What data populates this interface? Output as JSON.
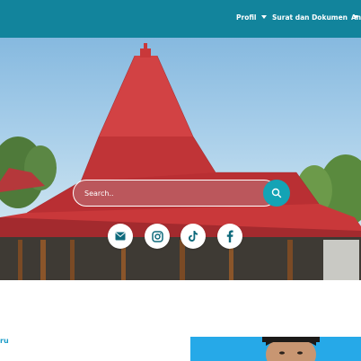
{
  "navbar": {
    "background": "#12849c",
    "items": [
      {
        "label": "Profil",
        "has_dropdown": true
      },
      {
        "label": "Surat dan Dokumen",
        "has_dropdown": true
      },
      {
        "label": "An",
        "has_dropdown": false
      }
    ]
  },
  "hero": {
    "search": {
      "placeholder": "Search..",
      "icon": "search-icon",
      "accent": "#14a3b5"
    },
    "social": [
      {
        "icon": "email-icon"
      },
      {
        "icon": "instagram-icon"
      },
      {
        "icon": "tiktok-icon"
      },
      {
        "icon": "facebook-icon"
      }
    ]
  },
  "content": {
    "section_link": "ru",
    "profile_card_color": "#26a9e8"
  }
}
